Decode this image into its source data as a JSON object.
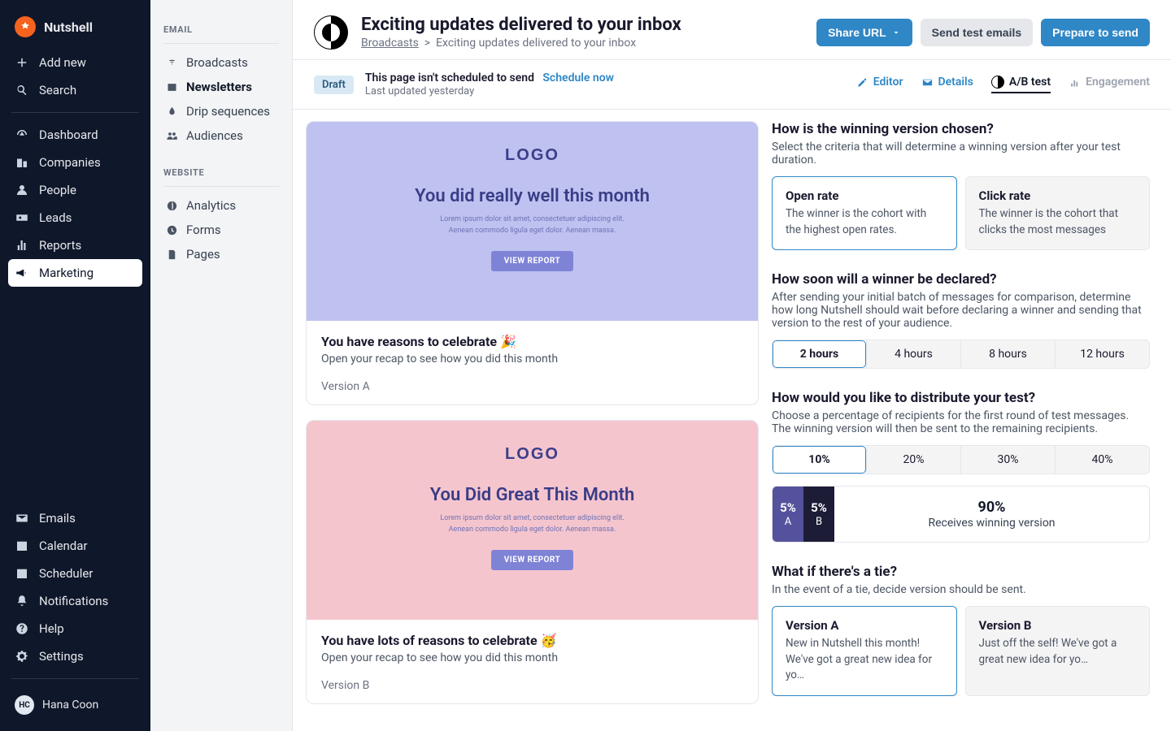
{
  "brand": {
    "name": "Nutshell"
  },
  "nav": {
    "add": "Add new",
    "search": "Search",
    "items": [
      {
        "label": "Dashboard"
      },
      {
        "label": "Companies"
      },
      {
        "label": "People"
      },
      {
        "label": "Leads"
      },
      {
        "label": "Reports"
      },
      {
        "label": "Marketing"
      }
    ],
    "bottom": [
      {
        "label": "Emails"
      },
      {
        "label": "Calendar"
      },
      {
        "label": "Scheduler"
      },
      {
        "label": "Notifications"
      },
      {
        "label": "Help"
      },
      {
        "label": "Settings"
      }
    ]
  },
  "user": {
    "initials": "HC",
    "name": "Hana Coon"
  },
  "subnav": {
    "email_heading": "EMAIL",
    "email_items": [
      {
        "label": "Broadcasts"
      },
      {
        "label": "Newsletters"
      },
      {
        "label": "Drip sequences"
      },
      {
        "label": "Audiences"
      }
    ],
    "website_heading": "WEBSITE",
    "website_items": [
      {
        "label": "Analytics"
      },
      {
        "label": "Forms"
      },
      {
        "label": "Pages"
      }
    ]
  },
  "page": {
    "title": "Exciting updates delivered to your inbox",
    "breadcrumb_root": "Broadcasts",
    "breadcrumb_sep": ">",
    "breadcrumb_current": "Exciting updates delivered to your inbox",
    "share_label": "Share URL",
    "send_test_label": "Send test emails",
    "prepare_label": "Prepare to send"
  },
  "status": {
    "badge": "Draft",
    "line": "This page isn't scheduled to send",
    "link": "Schedule now",
    "sub": "Last updated yesterday"
  },
  "tabs": {
    "editor": "Editor",
    "details": "Details",
    "abtest": "A/B test",
    "engagement": "Engagement"
  },
  "previews": {
    "a": {
      "logo": "LOGO",
      "headline": "You did really well this month",
      "lorem1": "Lorem ipsum dolor sit amet, consectetuer adipiscing elit.",
      "lorem2": "Aenean commodo ligula eget dolor. Aenean massa.",
      "btn": "VIEW REPORT",
      "title": "You have reasons to celebrate 🎉",
      "sub": "Open your recap to see how you did this month",
      "version": "Version A"
    },
    "b": {
      "logo": "LOGO",
      "headline": "You Did Great This Month",
      "lorem1": "Lorem ipsum dolor sit amet, consectetuer adipiscing elit.",
      "lorem2": "Aenean commodo ligula eget dolor. Aenean massa.",
      "btn": "VIEW REPORT",
      "title": "You have lots of reasons to celebrate 🥳",
      "sub": "Open your recap to see how you did this month",
      "version": "Version B"
    }
  },
  "ab": {
    "winner": {
      "heading": "How is the winning version chosen?",
      "desc": "Select the criteria that will determine a winning version after your test duration.",
      "open": {
        "title": "Open rate",
        "desc": "The winner is the cohort with the highest open rates."
      },
      "click": {
        "title": "Click rate",
        "desc": "The winner is the cohort that clicks the most messages"
      }
    },
    "timing": {
      "heading": "How soon will a winner be declared?",
      "desc": "After sending your initial batch of messages for comparison, determine how long Nutshell should wait before declaring a winner and sending that version to the rest of your audience.",
      "options": [
        "2 hours",
        "4 hours",
        "8 hours",
        "12 hours"
      ]
    },
    "distribute": {
      "heading": "How would you like to distribute your test?",
      "desc": "Choose a percentage of recipients for the first round of test messages. The winning version will then be sent to the remaining recipients.",
      "options": [
        "10%",
        "20%",
        "30%",
        "40%"
      ],
      "a_pct": "5%",
      "a_lab": "A",
      "b_pct": "5%",
      "b_lab": "B",
      "rest_pct": "90%",
      "rest_lab": "Receives winning version"
    },
    "tie": {
      "heading": "What if there's a tie?",
      "desc": "In the event of a tie, decide version should be sent.",
      "a": {
        "title": "Version A",
        "desc": "New in Nutshell this month! We've got a great new idea for yo…"
      },
      "b": {
        "title": "Version B",
        "desc": "Just off the self! We've got a great new idea for yo…"
      }
    }
  }
}
